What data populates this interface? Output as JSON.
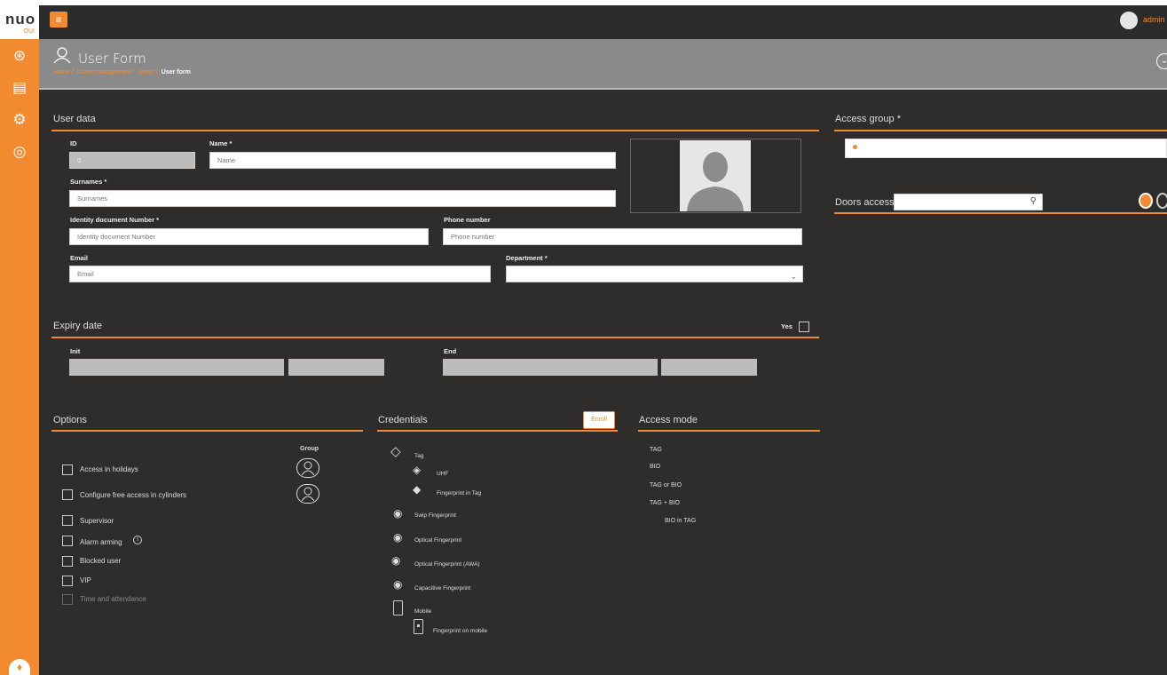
{
  "app": {
    "logo_text": "nuo",
    "logo_sub": "OUI",
    "user_name": "admin"
  },
  "header": {
    "title": "User Form",
    "breadcrumb": [
      "Home",
      "Users management",
      "Users",
      "User form"
    ]
  },
  "user_data": {
    "section_title": "User data",
    "id_label": "ID",
    "id_value": "0",
    "name_label": "Name *",
    "name_placeholder": "Name",
    "surnames_label": "Surnames *",
    "surnames_placeholder": "Surnames",
    "idnum_label": "Identity document Number *",
    "idnum_placeholder": "Identity document Number",
    "phone_label": "Phone number",
    "phone_placeholder": "Phone number",
    "email_label": "Email",
    "email_placeholder": "Email",
    "department_label": "Department *",
    "department_value": ""
  },
  "expiry": {
    "section_title": "Expiry date",
    "yes_label": "Yes",
    "init_label": "Init",
    "end_label": "End"
  },
  "options": {
    "section_title": "Options",
    "group_label": "Group",
    "items": [
      {
        "label": "Access in holidays",
        "checked": false
      },
      {
        "label": "Configure free access in cylinders",
        "checked": false
      },
      {
        "label": "Supervisor",
        "checked": false
      },
      {
        "label": "Alarm arming",
        "checked": false
      },
      {
        "label": "Blocked user",
        "checked": false
      },
      {
        "label": "VIP",
        "checked": false
      },
      {
        "label": "Time and attendance",
        "checked": false,
        "disabled": true
      }
    ]
  },
  "credentials": {
    "section_title": "Credentials",
    "enroll_label": "Enroll",
    "items": [
      {
        "label": "Tag",
        "icon": "tag-icon"
      },
      {
        "label": "UHF",
        "icon": "uhf-tag-icon"
      },
      {
        "label": "Fingerprint in Tag",
        "icon": "fingerprint-tag-icon"
      },
      {
        "label": "Swip Fingerprint",
        "icon": "swipe-fingerprint-icon"
      },
      {
        "label": "Optical Fingerprint",
        "icon": "optical-fingerprint-icon"
      },
      {
        "label": "Optical Fingerprint (AWA)",
        "icon": "optical-fingerprint-awa-icon"
      },
      {
        "label": "Capacitive Fingerprint",
        "icon": "capacitive-fingerprint-icon"
      },
      {
        "label": "Mobile",
        "icon": "mobile-icon"
      },
      {
        "label": "Fingerprint on mobile",
        "icon": "mobile-fingerprint-icon"
      }
    ]
  },
  "access_mode": {
    "section_title": "Access mode",
    "items": [
      "TAG",
      "BIO",
      "TAG or BIO",
      "TAG + BIO",
      "BIO in TAG"
    ]
  },
  "access_group": {
    "section_title": "Access group *"
  },
  "doors_access": {
    "section_title": "Doors access"
  },
  "colors": {
    "accent": "#f28b30",
    "background": "#2e2d2c",
    "header": "#8a8a8a"
  }
}
